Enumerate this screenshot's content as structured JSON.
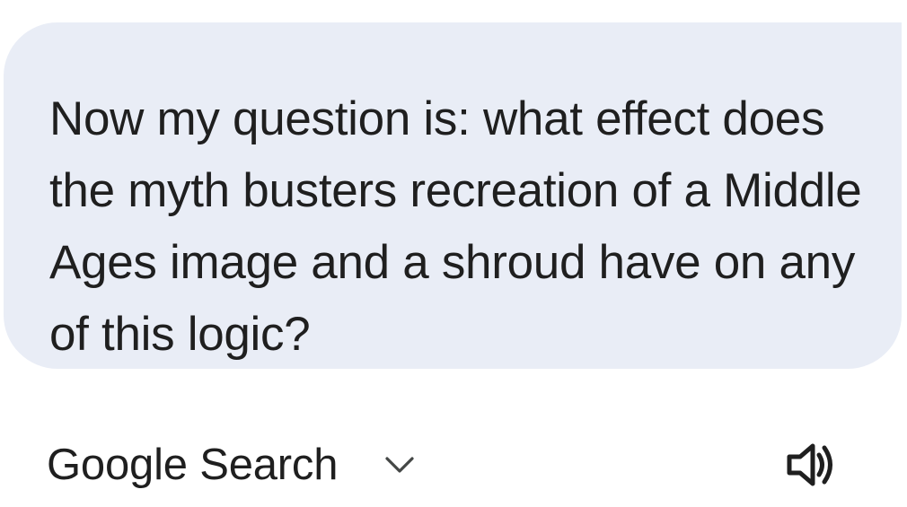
{
  "message": {
    "text": "Now my question is: what effect does the myth busters recreation of a Middle Ages image and a shroud have on any of this logic?",
    "bubble_color": "#e9edf6",
    "text_color": "#1f1f1f"
  },
  "footer": {
    "source_label": "Google Search",
    "dropdown_icon": "chevron-down-icon",
    "audio_icon": "speaker-icon"
  }
}
